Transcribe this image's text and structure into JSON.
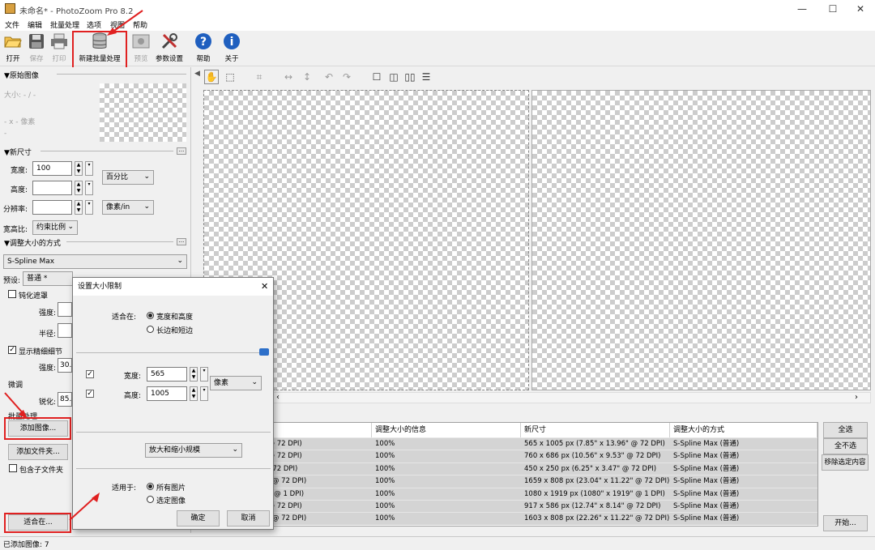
{
  "window": {
    "title": "未命名* - PhotoZoom Pro 8.2",
    "minimize": "—",
    "maximize": "☐",
    "close": "✕"
  },
  "menu": [
    "文件",
    "编辑",
    "批量处理",
    "选项",
    "视图",
    "帮助"
  ],
  "toolbar": {
    "open": "打开",
    "save": "保存",
    "print": "打印",
    "new_batch": "新建批量处理",
    "preview": "预览",
    "params": "参数设置",
    "help": "帮助",
    "about": "关于"
  },
  "sidebar": {
    "original_image": {
      "header": "▼原始图像",
      "size": "大小: - / -",
      "dims": "- x - 像素",
      "dash": "-"
    },
    "new_size": {
      "header": "▼新尺寸",
      "dots": "...",
      "width_label": "宽度:",
      "width_value": "100",
      "height_label": "高度:",
      "height_value": "",
      "resolution_label": "分辨率:",
      "resolution_value": "",
      "unit": "百分比",
      "res_unit": "像素/in",
      "aspect_label": "宽高比:",
      "aspect_value": "约束比例"
    },
    "resize_method": {
      "header": "▼调整大小的方式",
      "dots": "...",
      "method": "S-Spline Max",
      "preset_label": "预设:",
      "preset_value": "普通 *"
    },
    "sharpen_mask": {
      "label": "钝化遮罩",
      "strength_label": "强度:",
      "radius_label": "半径:"
    },
    "show_detail": {
      "label": "显示精细细节",
      "strength_label": "强度:",
      "strength_value": "30.0"
    },
    "fine_tune": {
      "label": "微调",
      "sharpen_label": "锐化:",
      "sharpen_value": "85.0"
    },
    "batch": {
      "label": "批量处理",
      "add_image": "添加图像...",
      "add_folder": "添加文件夹...",
      "include_sub": "包含子文件夹",
      "fit_in": "适合在..."
    }
  },
  "table": {
    "headers": [
      "",
      "调整大小的信息",
      "新尺寸",
      "调整大小的方式"
    ],
    "rows": [
      {
        "orig": "(7.85\" x 13.96\" @ 72 DPI)",
        "info": "100%",
        "newsize": "565 x 1005 px (7.85\" x 13.96\" @ 72 DPI)",
        "method": "S-Spline Max (普通)"
      },
      {
        "orig": "(10.56\" x 9.53\" @ 72 DPI)",
        "info": "100%",
        "newsize": "760 x 686 px (10.56\" x 9.53\" @ 72 DPI)",
        "method": "S-Spline Max (普通)"
      },
      {
        "orig": "(6.25\" x 3.47\" @ 72 DPI)",
        "info": "100%",
        "newsize": "450 x 250 px (6.25\" x 3.47\" @ 72 DPI)",
        "method": "S-Spline Max (普通)"
      },
      {
        "orig": "(23.04\" x 11.22\" @ 72 DPI)",
        "info": "100%",
        "newsize": "1659 x 808 px (23.04\" x 11.22\" @ 72 DPI)",
        "method": "S-Spline Max (普通)"
      },
      {
        "orig": "x (1080\" x 1919\" @ 1 DPI)",
        "info": "100%",
        "newsize": "1080 x 1919 px (1080\" x 1919\" @ 1 DPI)",
        "method": "S-Spline Max (普通)"
      },
      {
        "orig": "(12.74\" x 8.14\" @ 72 DPI)",
        "info": "100%",
        "newsize": "917 x 586 px (12.74\" x 8.14\" @ 72 DPI)",
        "method": "S-Spline Max (普通)"
      },
      {
        "orig": "(22.26\" x 11.22\" @ 72 DPI)",
        "info": "100%",
        "newsize": "1603 x 808 px (22.26\" x 11.22\" @ 72 DPI)",
        "method": "S-Spline Max (普通)"
      }
    ]
  },
  "right_buttons": {
    "select_all": "全选",
    "select_none": "全不选",
    "remove_selected": "移除选定内容",
    "start": "开始..."
  },
  "dialog": {
    "title": "设置大小限制",
    "close": "✕",
    "fit_label": "适合在:",
    "fit_opt1": "宽度和高度",
    "fit_opt2": "长边和短边",
    "width_label": "宽度:",
    "width_value": "565",
    "height_label": "高度:",
    "height_value": "1005",
    "unit": "像素",
    "scale_option": "放大和缩小规模",
    "apply_label": "适用于:",
    "apply_opt1": "所有图片",
    "apply_opt2": "选定图像",
    "ok": "确定",
    "cancel": "取消"
  },
  "status": {
    "text": "已添加图像: 7"
  },
  "colors": {
    "highlight": "#e02020",
    "button_blue": "#1f5fbf"
  }
}
